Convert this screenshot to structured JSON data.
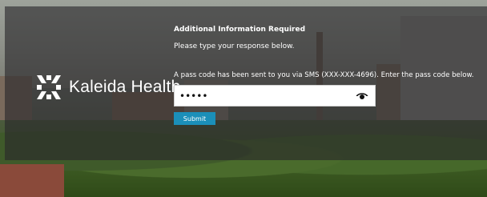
{
  "brand": {
    "name": "Kaleida Health",
    "logo_icon": "kaleida-logo-icon"
  },
  "form": {
    "heading": "Additional Information Required",
    "instruction": "Please type your response below.",
    "message": "A pass code has been sent to you via SMS (XXX-XXX-4696). Enter the pass code below.",
    "passcode_value": "•••••",
    "reveal_icon": "eye-icon",
    "submit_label": "Submit"
  },
  "colors": {
    "accent": "#1b8fb9",
    "overlay": "#28262a"
  }
}
